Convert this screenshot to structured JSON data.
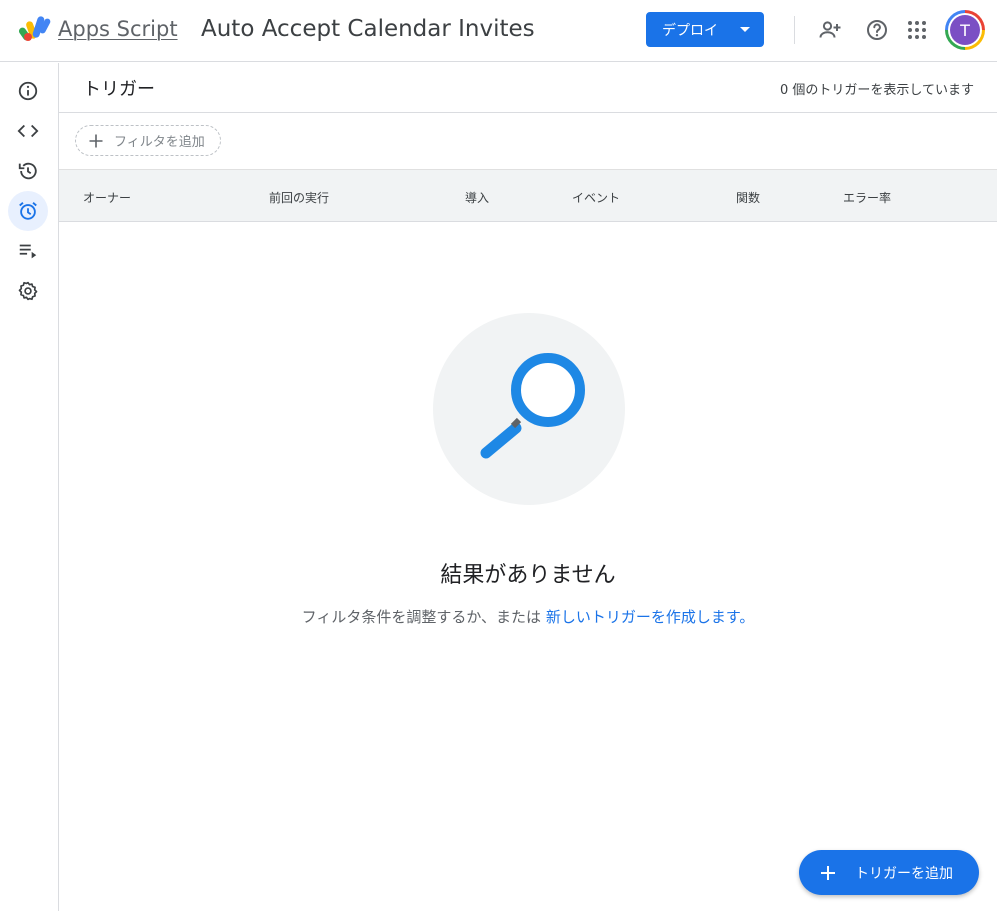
{
  "header": {
    "app_name": "Apps Script",
    "project_title": "Auto Accept Calendar Invites",
    "deploy_label": "デプロイ",
    "avatar_initial": "T"
  },
  "leftrail": {
    "items": [
      {
        "name": "overview",
        "icon": "info-icon",
        "active": false
      },
      {
        "name": "editor",
        "icon": "code-icon",
        "active": false
      },
      {
        "name": "executions-history",
        "icon": "history-icon",
        "active": false
      },
      {
        "name": "triggers",
        "icon": "alarm-icon",
        "active": true
      },
      {
        "name": "executions",
        "icon": "playlist-play-icon",
        "active": false
      },
      {
        "name": "settings",
        "icon": "gear-icon",
        "active": false
      }
    ]
  },
  "page": {
    "title": "トリガー",
    "count_text": "0 個のトリガーを表示しています",
    "filter_label": "フィルタを追加"
  },
  "table": {
    "columns": [
      "オーナー",
      "前回の実行",
      "導入",
      "イベント",
      "関数",
      "エラー率"
    ]
  },
  "empty_state": {
    "title": "結果がありません",
    "subtitle_prefix": "フィルタ条件を調整するか、または ",
    "subtitle_link": "新しいトリガーを作成します。"
  },
  "fab": {
    "label": "トリガーを追加"
  },
  "colors": {
    "accent": "#1a73e8",
    "magnifier": "#1e88e5",
    "active_rail_bg": "#e8f0fe"
  }
}
